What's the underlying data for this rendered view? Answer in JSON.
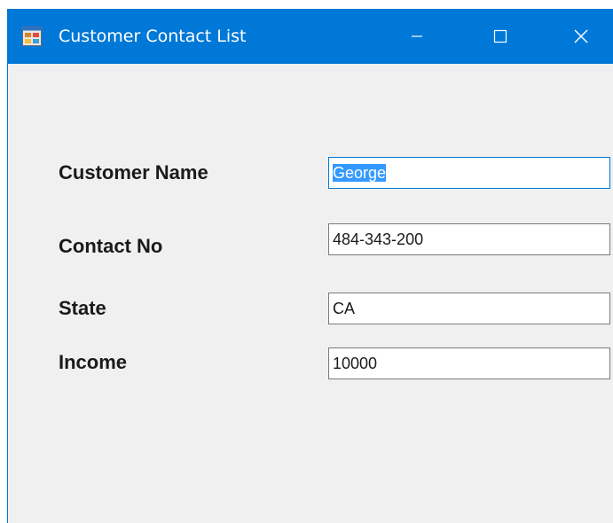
{
  "window": {
    "title": "Customer Contact List",
    "accent_color": "#0078d7",
    "icon": "form-app-icon",
    "controls": {
      "minimize_icon": "minimize-icon",
      "maximize_icon": "maximize-icon",
      "close_icon": "close-icon"
    }
  },
  "form": {
    "customer_name": {
      "label": "Customer Name",
      "value": "George",
      "selected": true
    },
    "contact_no": {
      "label": "Contact No",
      "value": "484-343-200"
    },
    "state": {
      "label": "State",
      "value": "CA"
    },
    "income": {
      "label": "Income",
      "value": "10000"
    }
  }
}
